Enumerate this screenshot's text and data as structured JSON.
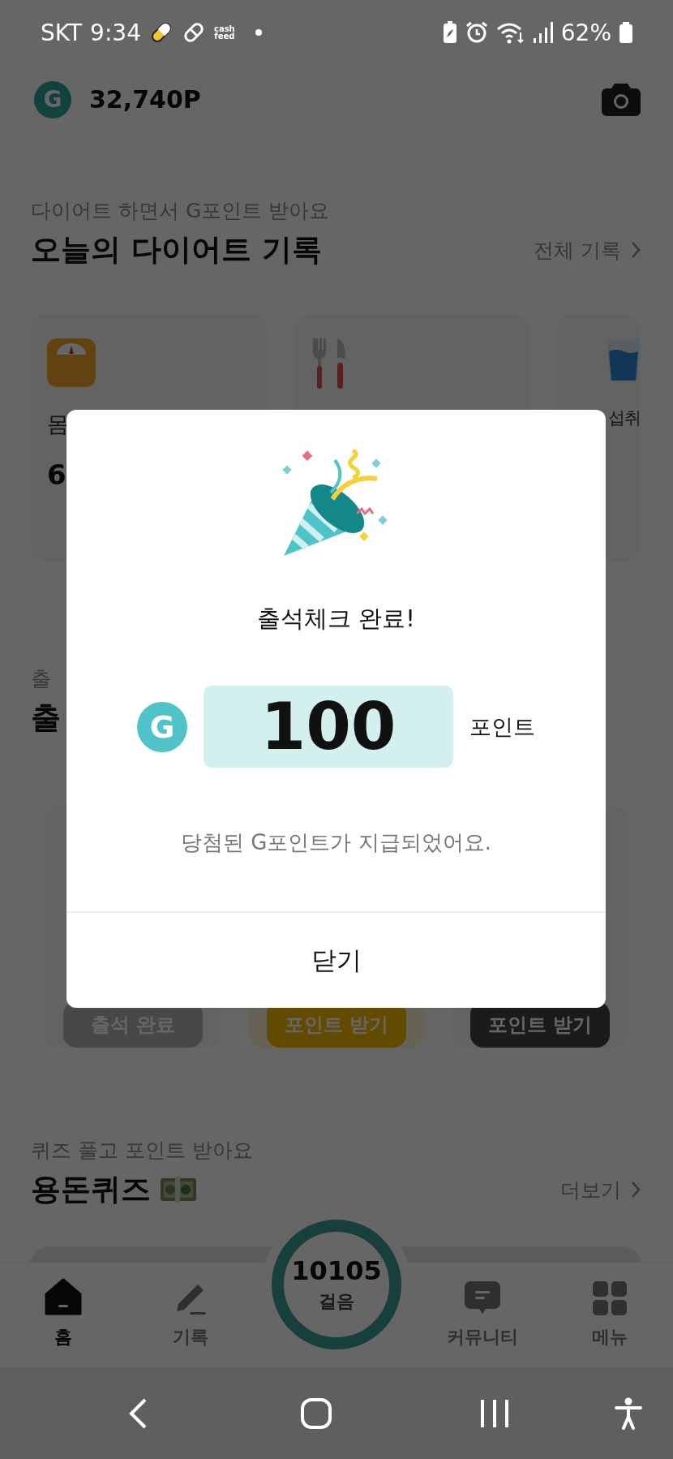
{
  "status_bar": {
    "carrier": "SKT",
    "time": "9:34",
    "notification_text": [
      "cash",
      "feed"
    ],
    "battery": "62%"
  },
  "header": {
    "logo_letter": "G",
    "points": "32,740P"
  },
  "diet_section": {
    "subtitle": "다이어트 하면서 G포인트 받아요",
    "title": "오늘의 다이어트 기록",
    "more": "전체 기록"
  },
  "diet_cards": [
    {
      "kind": "scale",
      "label": "몸",
      "value": "6"
    },
    {
      "kind": "meal"
    },
    {
      "kind": "water",
      "label": "섭취"
    }
  ],
  "attendance_section": {
    "subtitle": "출",
    "title": "출"
  },
  "attendance_cards": [
    {
      "kind": "done",
      "button": "출석 완료"
    },
    {
      "kind": "active",
      "button": "포인트 받기"
    },
    {
      "kind": "locked",
      "button": "포인트 받기"
    }
  ],
  "quiz_section": {
    "subtitle": "퀴즈 풀고 포인트 받아요",
    "title": "용돈퀴즈",
    "more": "더보기"
  },
  "steps": {
    "count": "10105",
    "label": "걸음"
  },
  "bottom_nav": [
    {
      "kind": "home",
      "label": "홈",
      "selected": true
    },
    {
      "kind": "record",
      "label": "기록",
      "selected": false
    },
    {
      "kind": "community",
      "label": "커뮤니티",
      "selected": false
    },
    {
      "kind": "menu",
      "label": "메뉴",
      "selected": false
    }
  ],
  "dialog": {
    "title": "출석체크 완료!",
    "logo_letter": "G",
    "amount": "100",
    "unit": "포인트",
    "message": "당첨된 G포인트가 지급되었어요.",
    "close": "닫기"
  }
}
